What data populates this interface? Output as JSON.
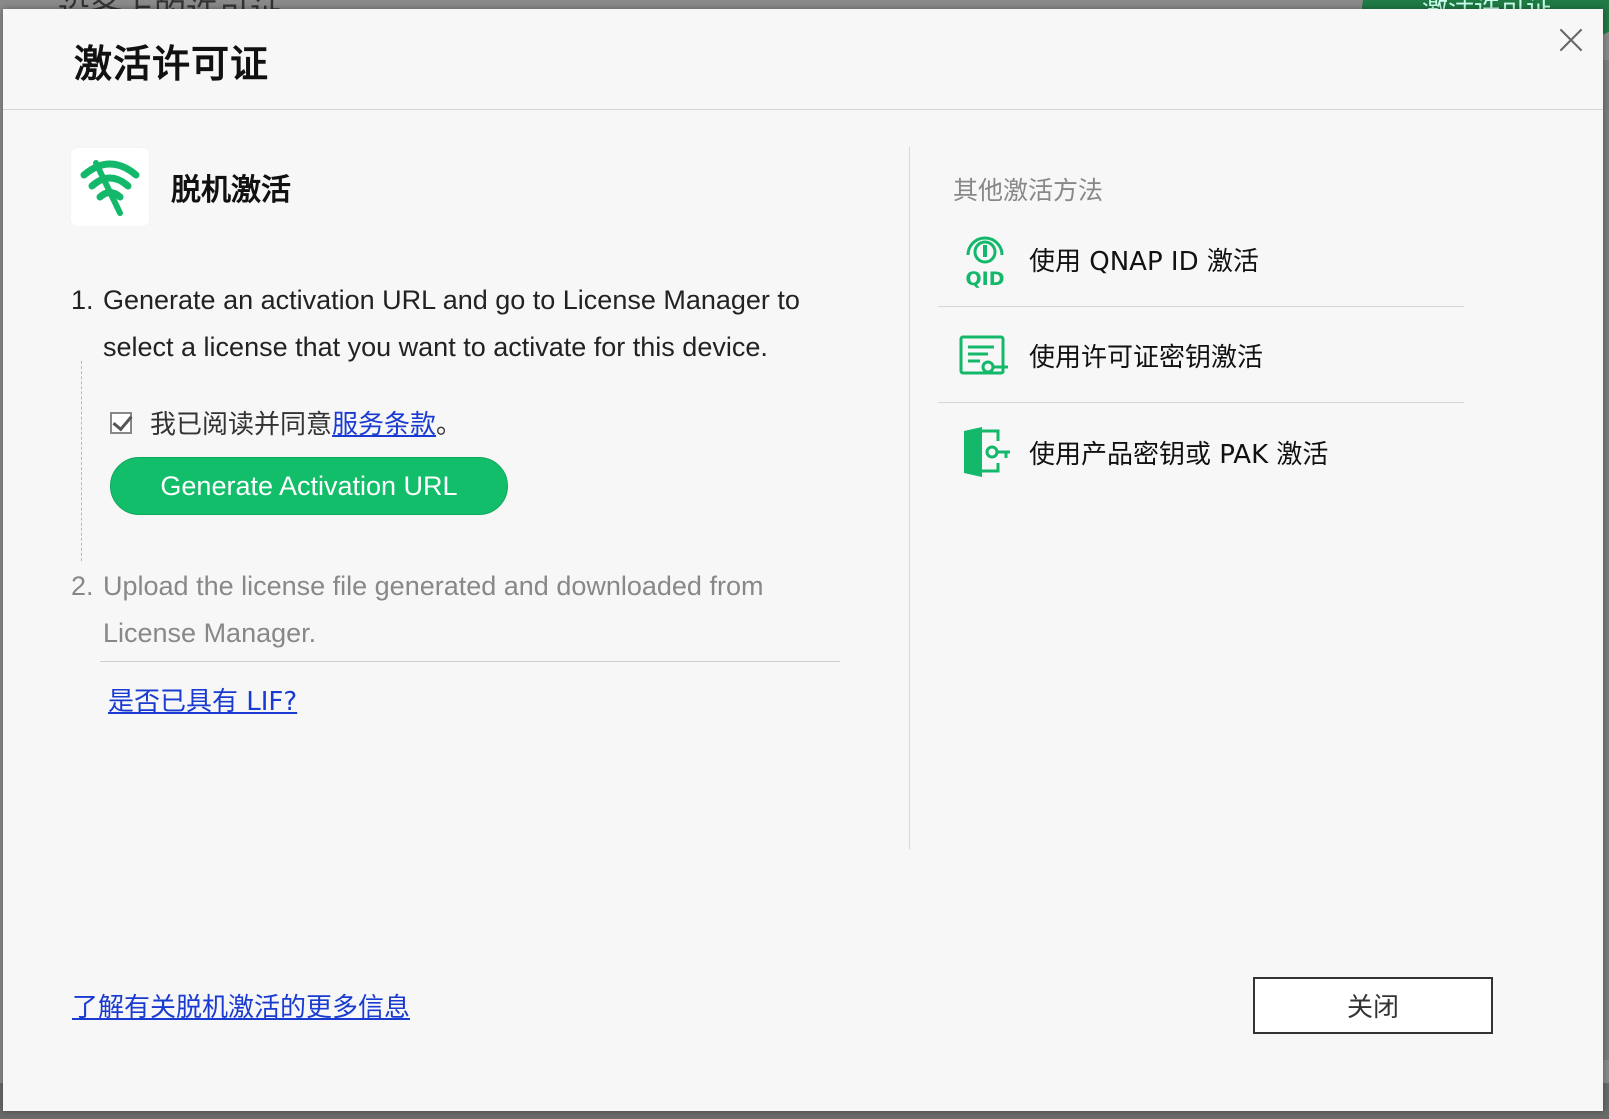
{
  "background": {
    "page_title": "设备上的许可证",
    "action_button_label": "激活许可证"
  },
  "dialog": {
    "title": "激活许可证",
    "close_icon": "close-icon"
  },
  "offline": {
    "icon": "wifi-off-icon",
    "title": "脱机激活",
    "step1_number": "1.",
    "step1_text": "Generate an activation URL and go to License Manager to select a license that you want to activate for this device.",
    "agree_prefix": "我已阅读并同意",
    "agree_link": "服务条款",
    "agree_suffix": "。",
    "agree_checked": true,
    "generate_button": "Generate Activation URL",
    "step2_number": "2.",
    "step2_text": "Upload the license file generated and downloaded from License Manager.",
    "lif_link": "是否已具有 LIF?"
  },
  "other_methods": {
    "title": "其他激活方法",
    "items": [
      {
        "icon": "qid-icon",
        "label": "使用 QNAP ID 激活"
      },
      {
        "icon": "license-key-icon",
        "label": "使用许可证密钥激活"
      },
      {
        "icon": "product-key-door-icon",
        "label": "使用产品密钥或 PAK 激活"
      }
    ]
  },
  "footer": {
    "more_info_link": "了解有关脱机激活的更多信息",
    "close_button": "关闭"
  },
  "colors": {
    "accent_green": "#12be6a",
    "link_blue": "#1a3bd1"
  }
}
